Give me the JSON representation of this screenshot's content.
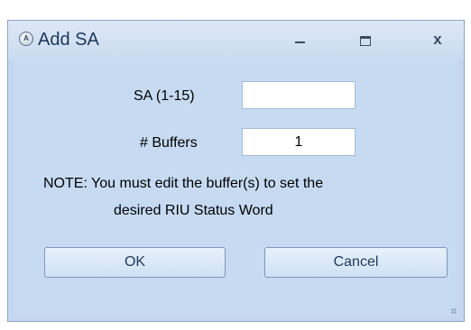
{
  "window": {
    "title": "Add SA",
    "app_icon_letter": "A",
    "controls": {
      "minimize": "minimize",
      "maximize": "maximize",
      "close": "x"
    }
  },
  "form": {
    "sa_label": "SA (1-15)",
    "sa_value": "",
    "buffers_label": "# Buffers",
    "buffers_value": "1"
  },
  "note": {
    "line1": "NOTE: You must edit the buffer(s) to set the",
    "line2": "desired RIU Status Word"
  },
  "buttons": {
    "ok_label": "OK",
    "cancel_label": "Cancel"
  },
  "icons": {
    "app": "app-icon",
    "minimize": "minimize-icon",
    "maximize": "maximize-icon",
    "close": "close-icon",
    "resize": "resize-grip-icon"
  }
}
